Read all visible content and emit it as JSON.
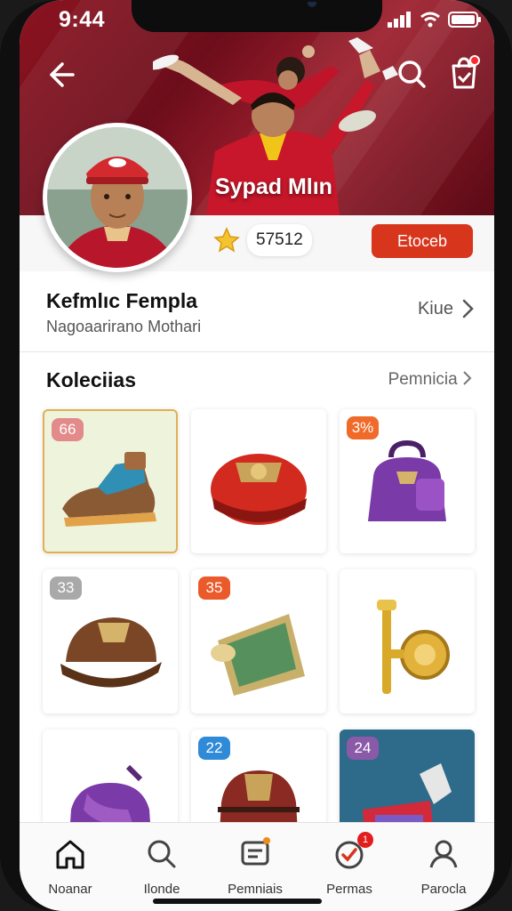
{
  "status": {
    "time": "9:44"
  },
  "profile": {
    "name": "Sypad Mlın",
    "rating": "57512",
    "follow_label": "Etoceb"
  },
  "info": {
    "title": "Kefmlıc Fempla",
    "subtitle": "Nagoaarirano Mothari",
    "link": "Kiue"
  },
  "collection": {
    "title": "Koleciias",
    "link": "Pemnicia",
    "items": [
      {
        "badge": "66",
        "badge_color": "#e38a8a",
        "item": "boot"
      },
      {
        "badge": "",
        "badge_color": "",
        "item": "red-helmet"
      },
      {
        "badge": "3%",
        "badge_color": "#f06a2a",
        "item": "purple-backpack"
      },
      {
        "badge": "33",
        "badge_color": "#a9a9a9",
        "item": "brown-cap"
      },
      {
        "badge": "35",
        "badge_color": "#ea5a2a",
        "item": "map-scroll"
      },
      {
        "badge": "",
        "badge_color": "",
        "item": "gold-key"
      },
      {
        "badge": "",
        "badge_color": "",
        "item": "purple-bag"
      },
      {
        "badge": "22",
        "badge_color": "#2f8ad8",
        "item": "red-backpack"
      },
      {
        "badge": "24",
        "badge_color": "#8a5aa8",
        "item": "red-bucket"
      }
    ]
  },
  "tabs": [
    {
      "label": "Noanar",
      "icon": "home-icon"
    },
    {
      "label": "Ilonde",
      "icon": "search-icon"
    },
    {
      "label": "Pemniais",
      "icon": "message-icon"
    },
    {
      "label": "Permas",
      "icon": "check-badge-icon",
      "badge": "1"
    },
    {
      "label": "Parocla",
      "icon": "person-icon"
    }
  ],
  "colors": {
    "accent": "#d8351d",
    "hero": "#8c1320"
  }
}
